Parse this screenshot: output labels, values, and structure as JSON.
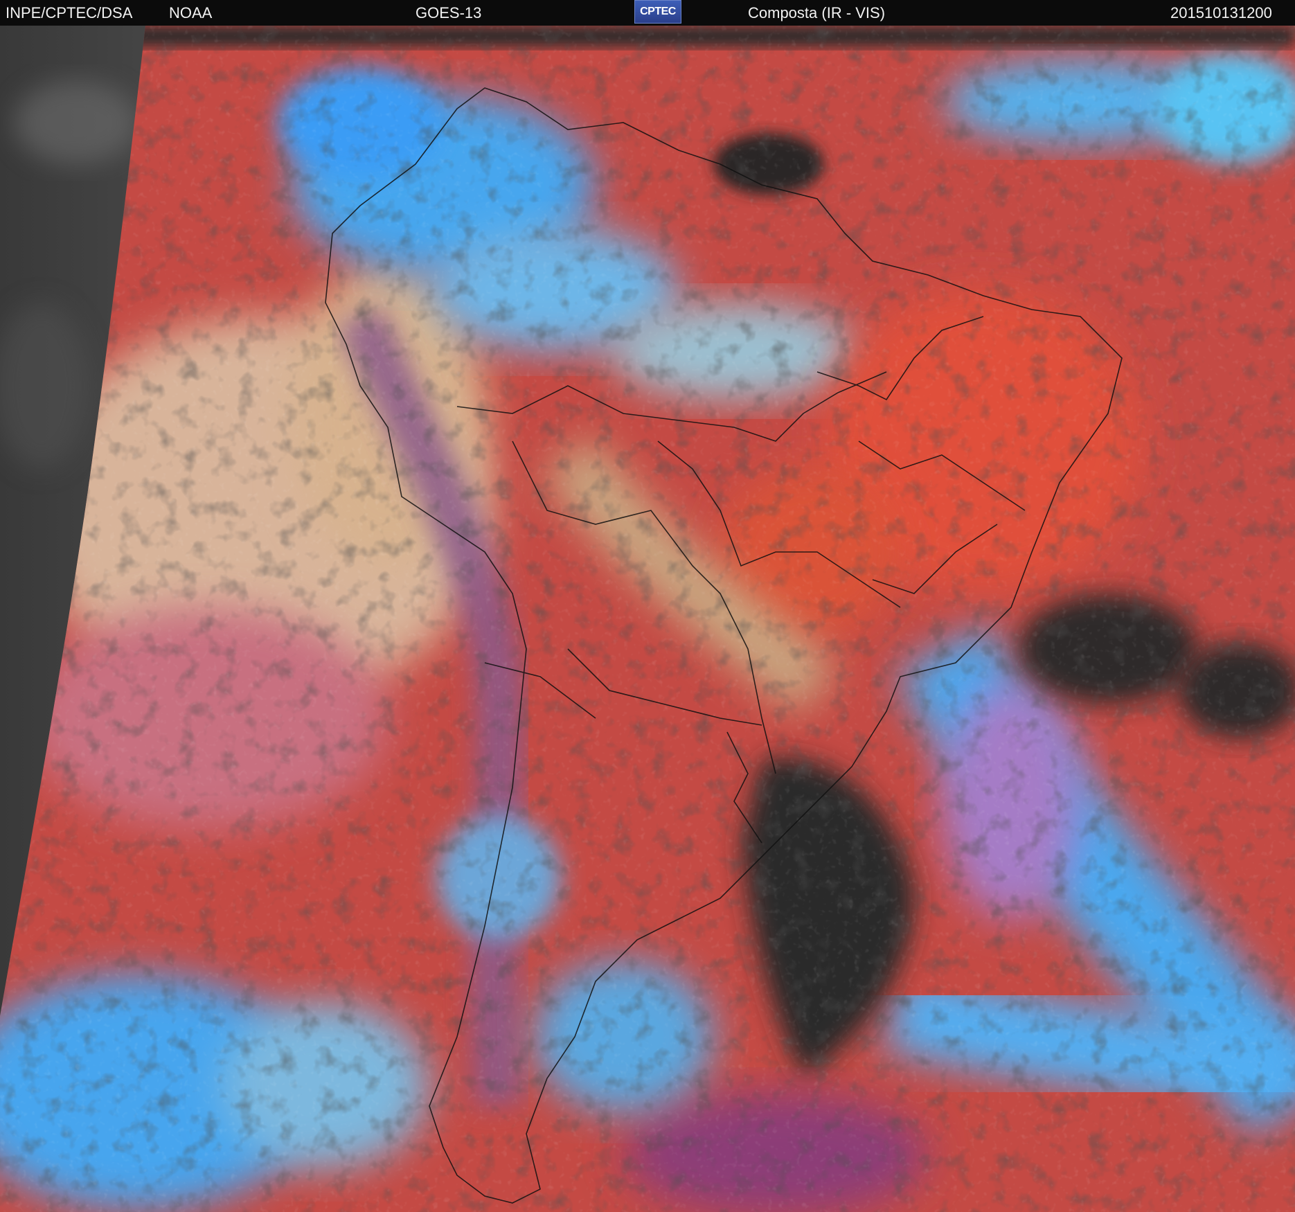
{
  "header": {
    "agency": "INPE/CPTEC/DSA",
    "source": "NOAA",
    "satellite": "GOES-13",
    "logo_text": "CPTEC",
    "product": "Composta (IR - VIS)",
    "timestamp": "201510131200"
  },
  "colors": {
    "header_bg": "#0b0b0b",
    "space_bg": "#2b2b2b",
    "land_clear": "#c8453c",
    "cloud_high": "#3fa8f0",
    "cloud_low": "#c9a088",
    "borders": "#111111"
  }
}
